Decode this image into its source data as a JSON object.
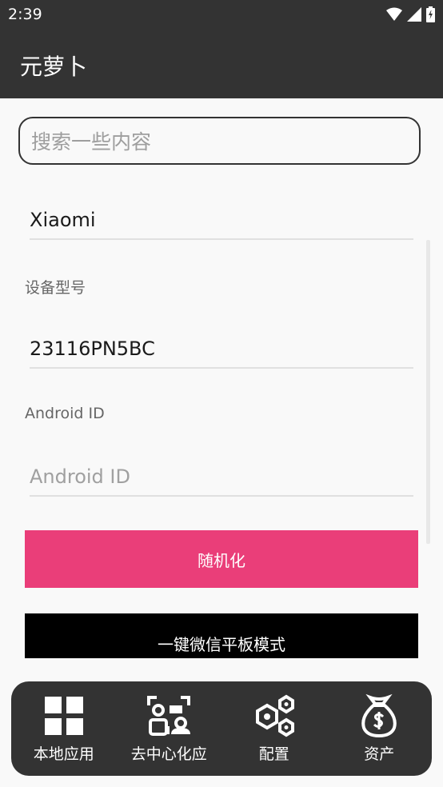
{
  "status_bar": {
    "time": "2:39",
    "icons": [
      "wifi-icon",
      "signal-icon",
      "battery-icon"
    ]
  },
  "app_bar": {
    "title": "元萝卜"
  },
  "search": {
    "placeholder": "搜索一些内容",
    "value": ""
  },
  "form": {
    "brand_value": "Xiaomi",
    "model_label": "设备型号",
    "model_value": "23116PN5BC",
    "android_id_label": "Android ID",
    "android_id_placeholder": "Android ID",
    "android_id_value": ""
  },
  "buttons": {
    "randomize": "随机化",
    "wechat_tablet": "一键微信平板模式"
  },
  "bottom_nav": {
    "items": [
      {
        "label": "本地应用",
        "icon": "grid-apps-icon"
      },
      {
        "label": "去中心化应",
        "icon": "devices-icon"
      },
      {
        "label": "配置",
        "icon": "hexagon-settings-icon"
      },
      {
        "label": "资产",
        "icon": "money-bag-icon"
      }
    ]
  },
  "colors": {
    "bar": "#333333",
    "accent": "#ea3e79",
    "background": "#f9f9f9"
  }
}
